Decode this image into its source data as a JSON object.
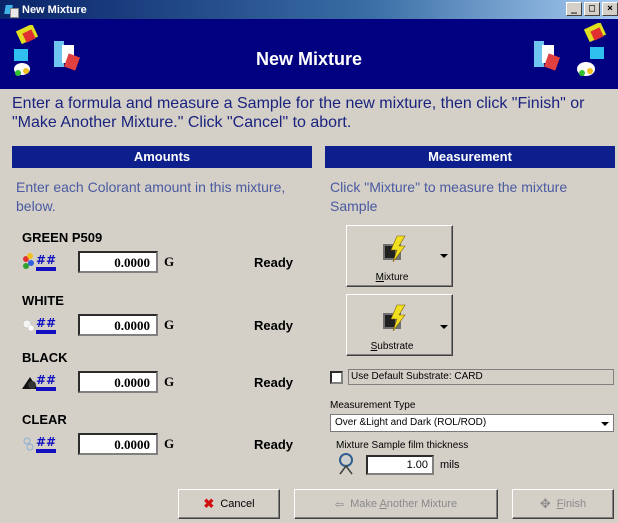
{
  "window": {
    "title": "New Mixture",
    "buttons": [
      "_",
      "□",
      "×"
    ]
  },
  "banner": {
    "title": "New Mixture"
  },
  "instructions": "Enter a formula and measure a Sample for the new mixture, then click \"Finish\" or \"Make Another Mixture.\"  Click \"Cancel\" to abort.",
  "amounts": {
    "header": "Amounts",
    "hint": "Enter each Colorant amount in this mixture, below.",
    "colorants": [
      {
        "name": "GREEN P509",
        "value": "0.0000",
        "unit": "G",
        "status": "Ready"
      },
      {
        "name": "WHITE",
        "value": "0.0000",
        "unit": "G",
        "status": "Ready"
      },
      {
        "name": "BLACK",
        "value": "0.0000",
        "unit": "G",
        "status": "Ready"
      },
      {
        "name": "CLEAR",
        "value": "0.0000",
        "unit": "G",
        "status": "Ready"
      }
    ]
  },
  "measurement": {
    "header": "Measurement",
    "hint": "Click \"Mixture\" to measure the mixture Sample",
    "mixture_button": {
      "underline": "M",
      "rest": "ixture"
    },
    "substrate_button": {
      "underline": "S",
      "rest": "ubstrate"
    },
    "use_default_substrate": "Use Default Substrate: CARD",
    "type_label": "Measurement Type",
    "type_value": "Over &Light and Dark (ROL/ROD)",
    "thickness_label": "Mixture Sample film thickness",
    "thickness_value": "1.00",
    "thickness_unit": "mils"
  },
  "footer": {
    "cancel": "Cancel",
    "make_another": {
      "pre": "Make ",
      "underline": "A",
      "post": "nother Mixture"
    },
    "finish": {
      "underline": "F",
      "rest": "inish"
    }
  },
  "colors": {
    "header_bg": "#0c1f8c",
    "banner_bg": "#000080",
    "instruction_text": "#1a237e",
    "hint_text": "#4a5aa0"
  }
}
